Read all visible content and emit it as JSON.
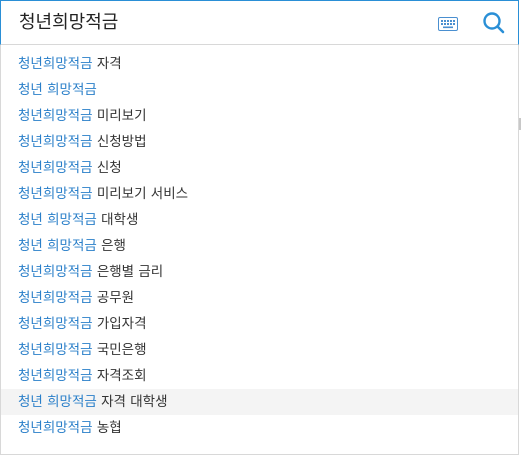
{
  "search": {
    "query": "청년희망적금"
  },
  "icons": {
    "keyboard": "keyboard-icon",
    "search": "magnifier-icon"
  },
  "colors": {
    "accent": "#2a8fd6",
    "highlight": "#2a7fc9",
    "text": "#333333",
    "active_row": "#f4f4f4"
  },
  "suggestions": [
    {
      "hl": "청년희망적금",
      "rest": " 자격"
    },
    {
      "hl": "청년 희망적금",
      "rest": ""
    },
    {
      "hl": "청년희망적금",
      "rest": " 미리보기"
    },
    {
      "hl": "청년희망적금",
      "rest": " 신청방법"
    },
    {
      "hl": "청년희망적금",
      "rest": " 신청"
    },
    {
      "hl": "청년희망적금",
      "rest": " 미리보기 서비스"
    },
    {
      "hl": "청년 희망적금",
      "rest": " 대학생"
    },
    {
      "hl": "청년 희망적금",
      "rest": " 은행"
    },
    {
      "hl": "청년희망적금",
      "rest": " 은행별 금리"
    },
    {
      "hl": "청년희망적금",
      "rest": " 공무원"
    },
    {
      "hl": "청년희망적금",
      "rest": " 가입자격"
    },
    {
      "hl": "청년희망적금",
      "rest": " 국민은행"
    },
    {
      "hl": "청년희망적금",
      "rest": " 자격조회"
    },
    {
      "hl": "청년 희망적금",
      "rest": " 자격 대학생"
    },
    {
      "hl": "청년희망적금",
      "rest": " 농협"
    }
  ]
}
